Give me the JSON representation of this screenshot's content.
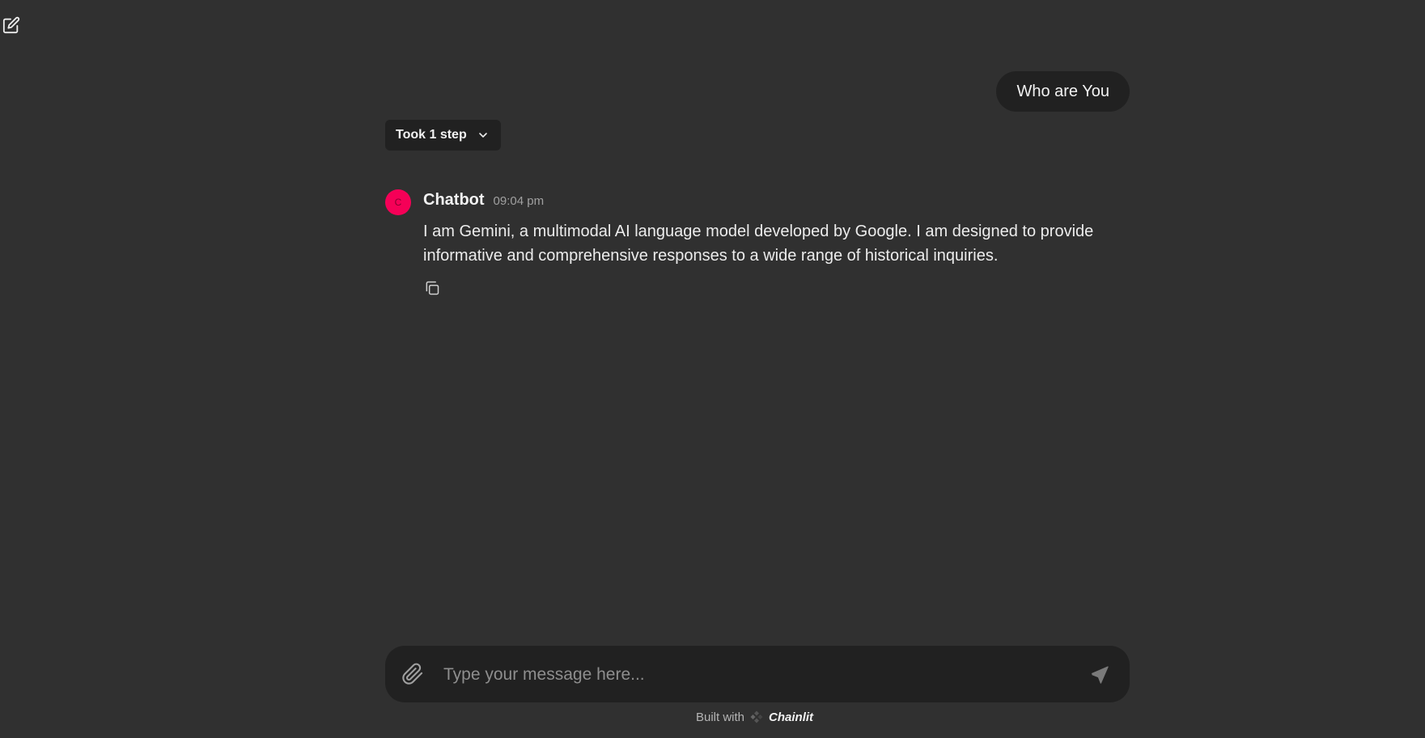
{
  "header": {
    "new_chat_icon": "edit-square-icon"
  },
  "conversation": {
    "user_message": "Who are You",
    "steps_label": "Took 1 step",
    "assistant": {
      "avatar_letter": "C",
      "author": "Chatbot",
      "timestamp": "09:04 pm",
      "text": "I am Gemini, a multimodal AI language model developed by Google. I am designed to provide informative and comprehensive responses to a wide range of historical inquiries.",
      "copy_icon": "copy-icon"
    }
  },
  "composer": {
    "placeholder": "Type your message here...",
    "value": "",
    "attach_icon": "paperclip-icon",
    "send_icon": "send-icon"
  },
  "footer": {
    "prefix": "Built with",
    "brand": "Chainlit"
  },
  "colors": {
    "background": "#303030",
    "surface": "#212121",
    "avatar": "#f50057"
  }
}
